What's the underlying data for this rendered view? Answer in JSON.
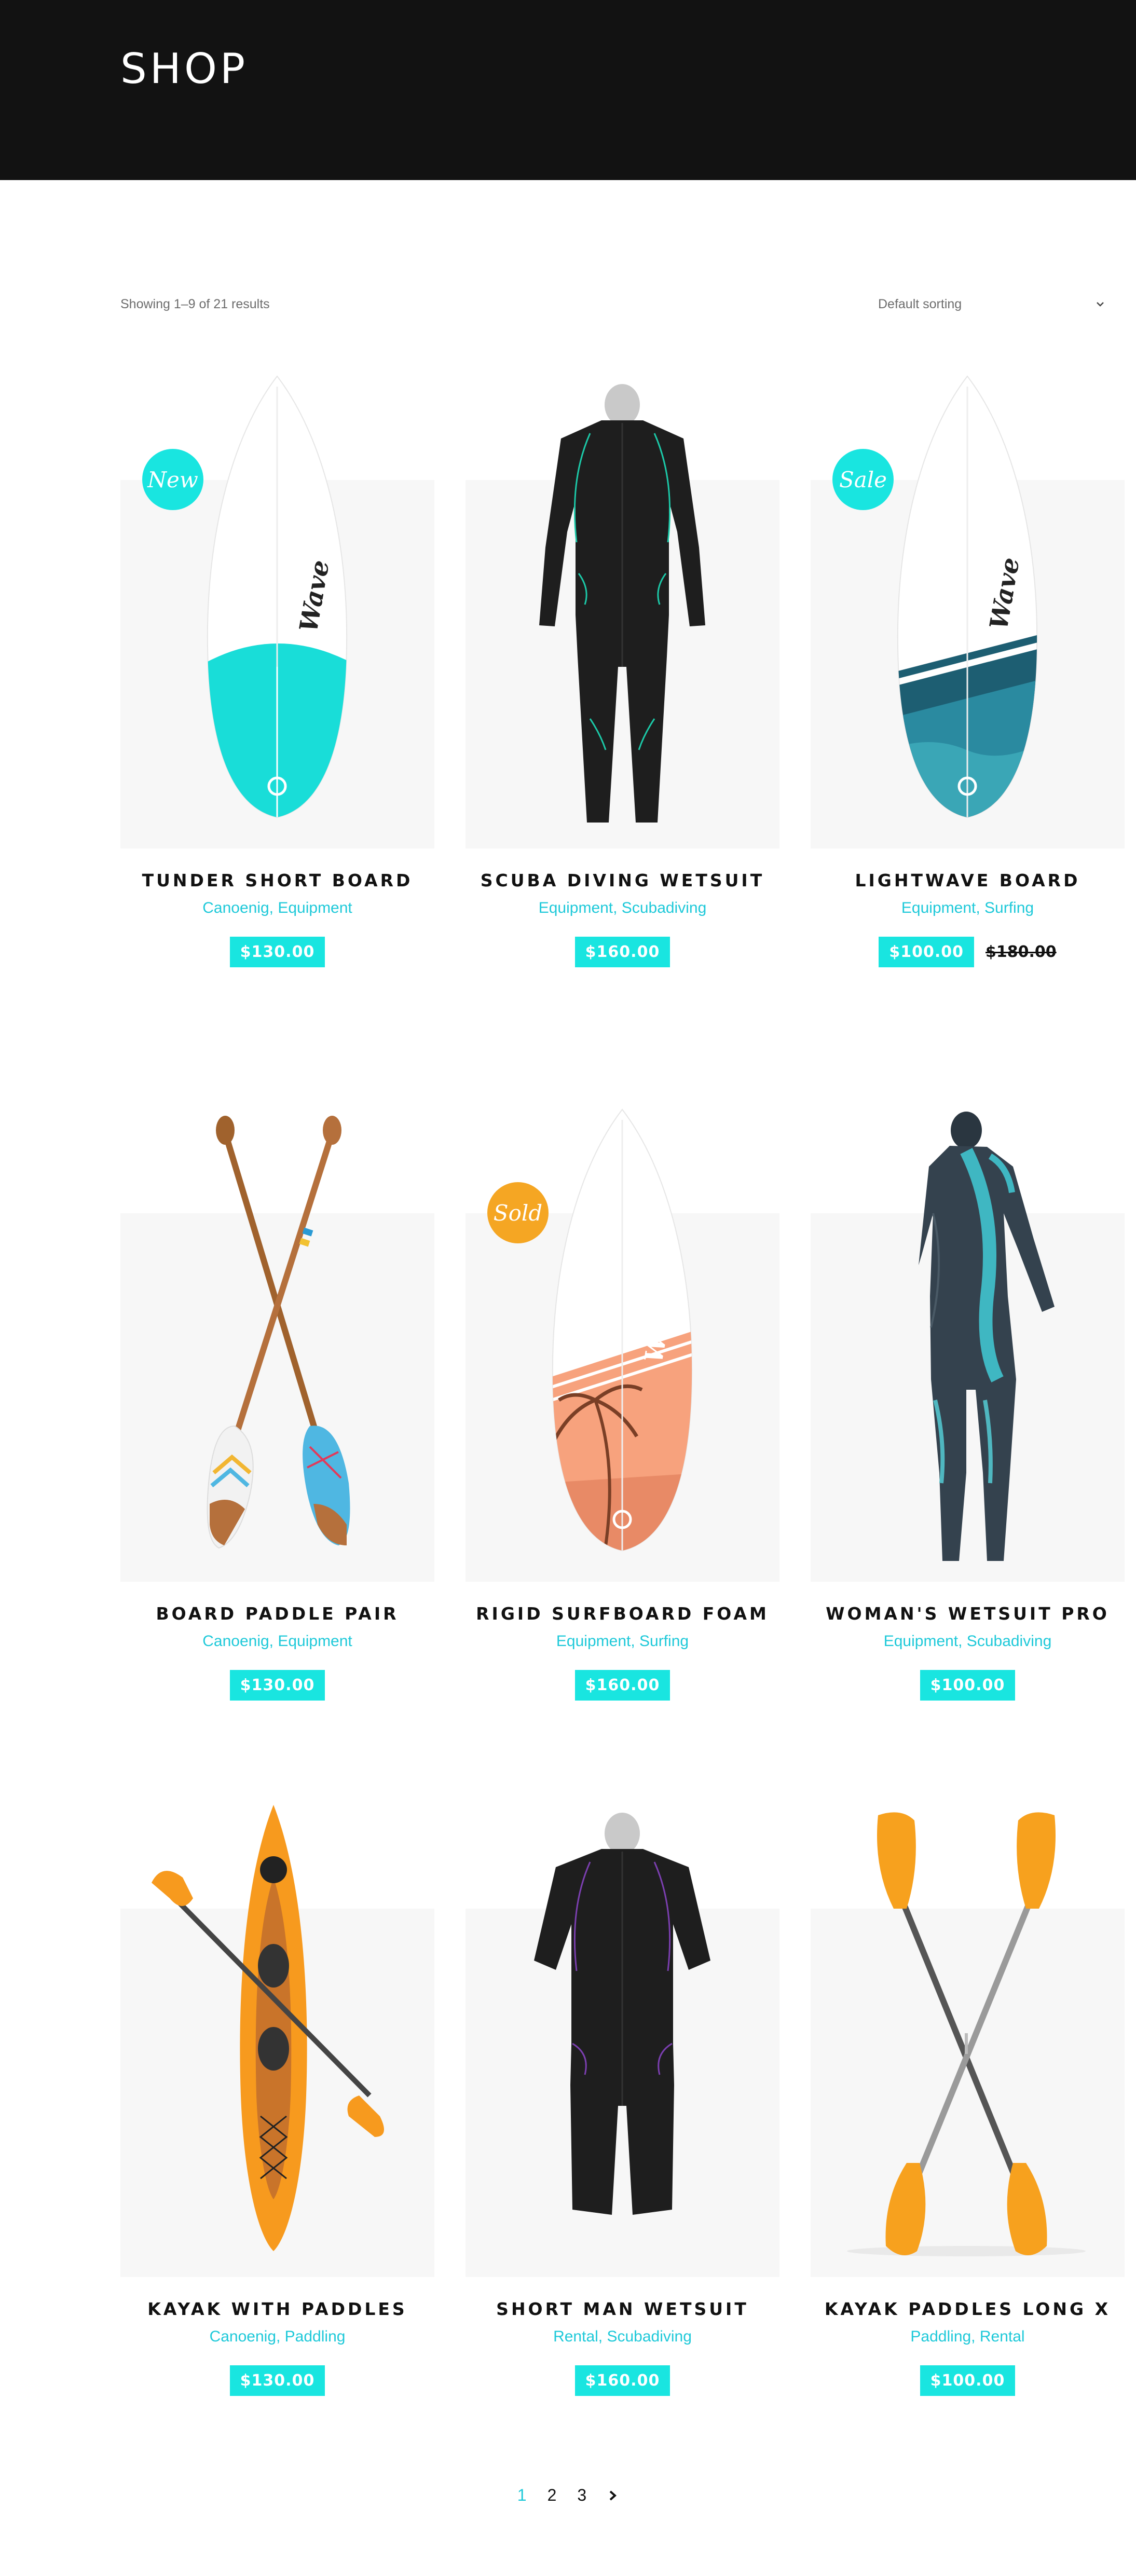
{
  "header": {
    "title": "SHOP"
  },
  "toolbar": {
    "result_count": "Showing 1–9 of 21 results",
    "sort_selected": "Default sorting"
  },
  "colors": {
    "accent": "#19e5e0",
    "category": "#1ec9d9",
    "hero_bg": "#121212",
    "sold_badge": "#f5a623"
  },
  "products": [
    {
      "title": "TUNDER SHORT BOARD",
      "categories": "Canoenig, Equipment",
      "price": "$130.00",
      "badge": "New",
      "image": "white-teal-surfboard"
    },
    {
      "title": "SCUBA DIVING WETSUIT",
      "categories": "Equipment, Scubadiving",
      "price": "$160.00",
      "image": "black-long-wetsuit"
    },
    {
      "title": "LIGHTWAVE BOARD",
      "categories": "Equipment, Surfing",
      "price": "$100.00",
      "old_price": "$180.00",
      "badge": "Sale",
      "image": "wave-surfboard"
    },
    {
      "title": "BOARD PADDLE PAIR",
      "categories": "Canoenig, Equipment",
      "price": "$130.00",
      "image": "wooden-paddle-pair"
    },
    {
      "title": "RIGID SURFBOARD FOAM",
      "categories": "Equipment, Surfing",
      "price": "$160.00",
      "badge": "Sold",
      "image": "sunset-surfboard"
    },
    {
      "title": "WOMAN'S WETSUIT PRO",
      "categories": "Equipment, Scubadiving",
      "price": "$100.00",
      "image": "womens-teal-wetsuit"
    },
    {
      "title": "KAYAK WITH PADDLES",
      "categories": "Canoenig, Paddling",
      "price": "$130.00",
      "image": "orange-kayak"
    },
    {
      "title": "SHORT MAN WETSUIT",
      "categories": "Rental, Scubadiving",
      "price": "$160.00",
      "image": "short-black-wetsuit"
    },
    {
      "title": "KAYAK PADDLES LONG X",
      "categories": "Paddling, Rental",
      "price": "$100.00",
      "image": "orange-paddles-crossed"
    }
  ],
  "pagination": {
    "pages": [
      "1",
      "2",
      "3"
    ],
    "current": "1"
  }
}
